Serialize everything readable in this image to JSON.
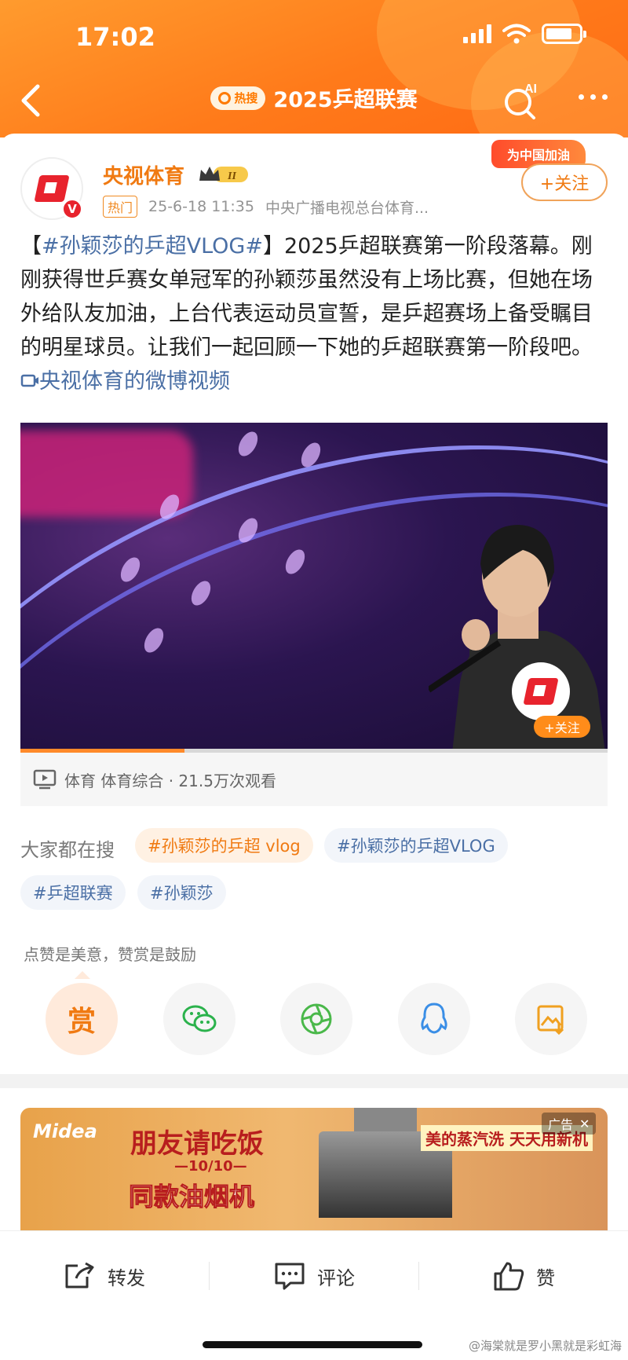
{
  "status_bar": {
    "time": "17:02"
  },
  "nav": {
    "hot_badge": "热搜",
    "title": "2025乒超联赛",
    "ai_label": "AI"
  },
  "post": {
    "author": "央视体育",
    "level_badge": "II",
    "hot_tag": "热门",
    "time": "25-6-18 11:35",
    "source": "中央广播电视总台体育...",
    "promo_banner": "为中国加油",
    "follow_label": "+关注",
    "text_hashtag": "#孙颖莎的乒超VLOG#",
    "text_body": "2025乒超联赛第一阶段落幕。刚刚获得世乒赛女单冠军的孙颖莎虽然没有上场比赛，但她在场外给队友加油，上台代表运动员宣誓，是乒超赛场上备受瞩目的明星球员。让我们一起回顾一下她的乒超联赛第一阶段吧。",
    "video_link": "央视体育的微博视频"
  },
  "video": {
    "follow_label": "+关注",
    "progress_fraction": 0.28,
    "info": "体育 体育综合 · 21.5万次观看"
  },
  "search": {
    "label": "大家都在搜",
    "chips": [
      "#孙颖莎的乒超 vlog",
      "#孙颖莎的乒超VLOG",
      "#乒超联赛",
      "#孙颖莎"
    ]
  },
  "reward": {
    "tip": "点赞是美意，赞赏是鼓励",
    "reward_label": "赏"
  },
  "ad": {
    "label": "广告",
    "brand": "Midea",
    "headline": "朋友请吃饭",
    "subline": "—10/10—",
    "product": "同款油烟机",
    "slogan": "美的蒸汽洗 天天用新机"
  },
  "bottom_bar": {
    "repost": "转发",
    "comment": "评论",
    "like": "赞"
  },
  "watermark": "@海棠就是罗小黑就是彩虹海"
}
